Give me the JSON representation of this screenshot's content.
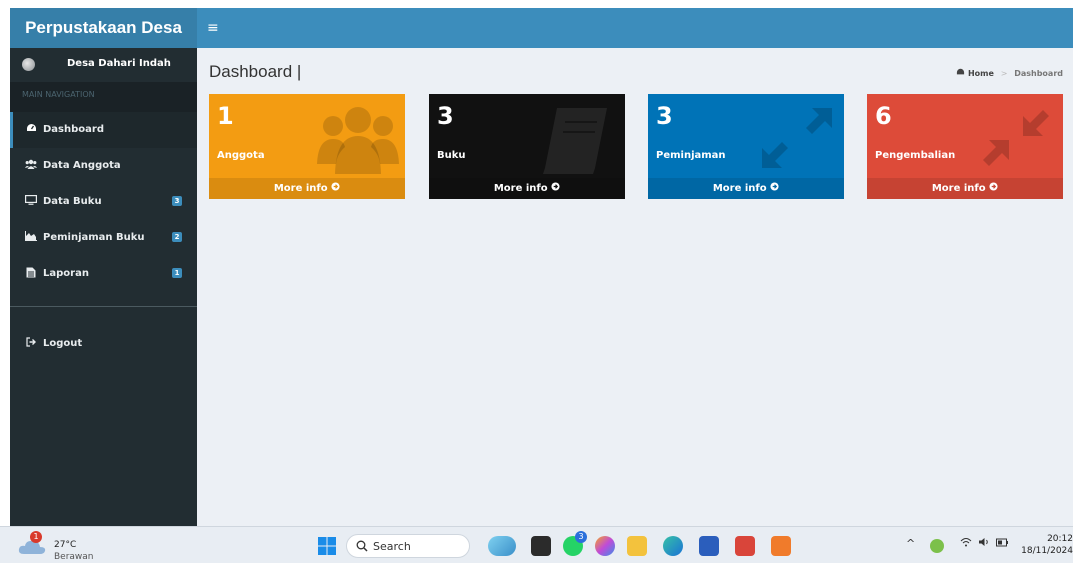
{
  "header": {
    "brand": "Perpustakaan Desa",
    "menu_toggle": "≡"
  },
  "sidebar": {
    "user_name": "Desa Dahari Indah",
    "nav_header": "MAIN NAVIGATION",
    "items": [
      {
        "label": "Dashboard",
        "icon": "dashboard-icon",
        "active": true
      },
      {
        "label": "Data Anggota",
        "icon": "users-icon"
      },
      {
        "label": "Data Buku",
        "icon": "monitor-icon",
        "badge": "3"
      },
      {
        "label": "Peminjaman Buku",
        "icon": "area-chart-icon",
        "badge": "2"
      },
      {
        "label": "Laporan",
        "icon": "file-icon",
        "badge": "1"
      }
    ],
    "logout": "Logout"
  },
  "content": {
    "title": "Dashboard |",
    "breadcrumb": {
      "home": "Home",
      "current": "Dashboard"
    }
  },
  "boxes": [
    {
      "count": "1",
      "label": "Anggota",
      "more": "More info",
      "color": "#f39c12",
      "icon": "users-icon"
    },
    {
      "count": "3",
      "label": "Buku",
      "more": "More info",
      "color": "#111111",
      "icon": "book-icon"
    },
    {
      "count": "3",
      "label": "Peminjaman",
      "more": "More info",
      "color": "#0073b7",
      "icon": "expand-arrows-icon"
    },
    {
      "count": "6",
      "label": "Pengembalian",
      "more": "More info",
      "color": "#dd4b39",
      "icon": "compress-arrows-icon"
    }
  ],
  "taskbar": {
    "weather_temp": "27°C",
    "weather_desc": "Berawan",
    "weather_alert": "1",
    "search": "Search",
    "whatsapp_badge": "3",
    "time": "20:12",
    "date": "18/11/2024"
  }
}
